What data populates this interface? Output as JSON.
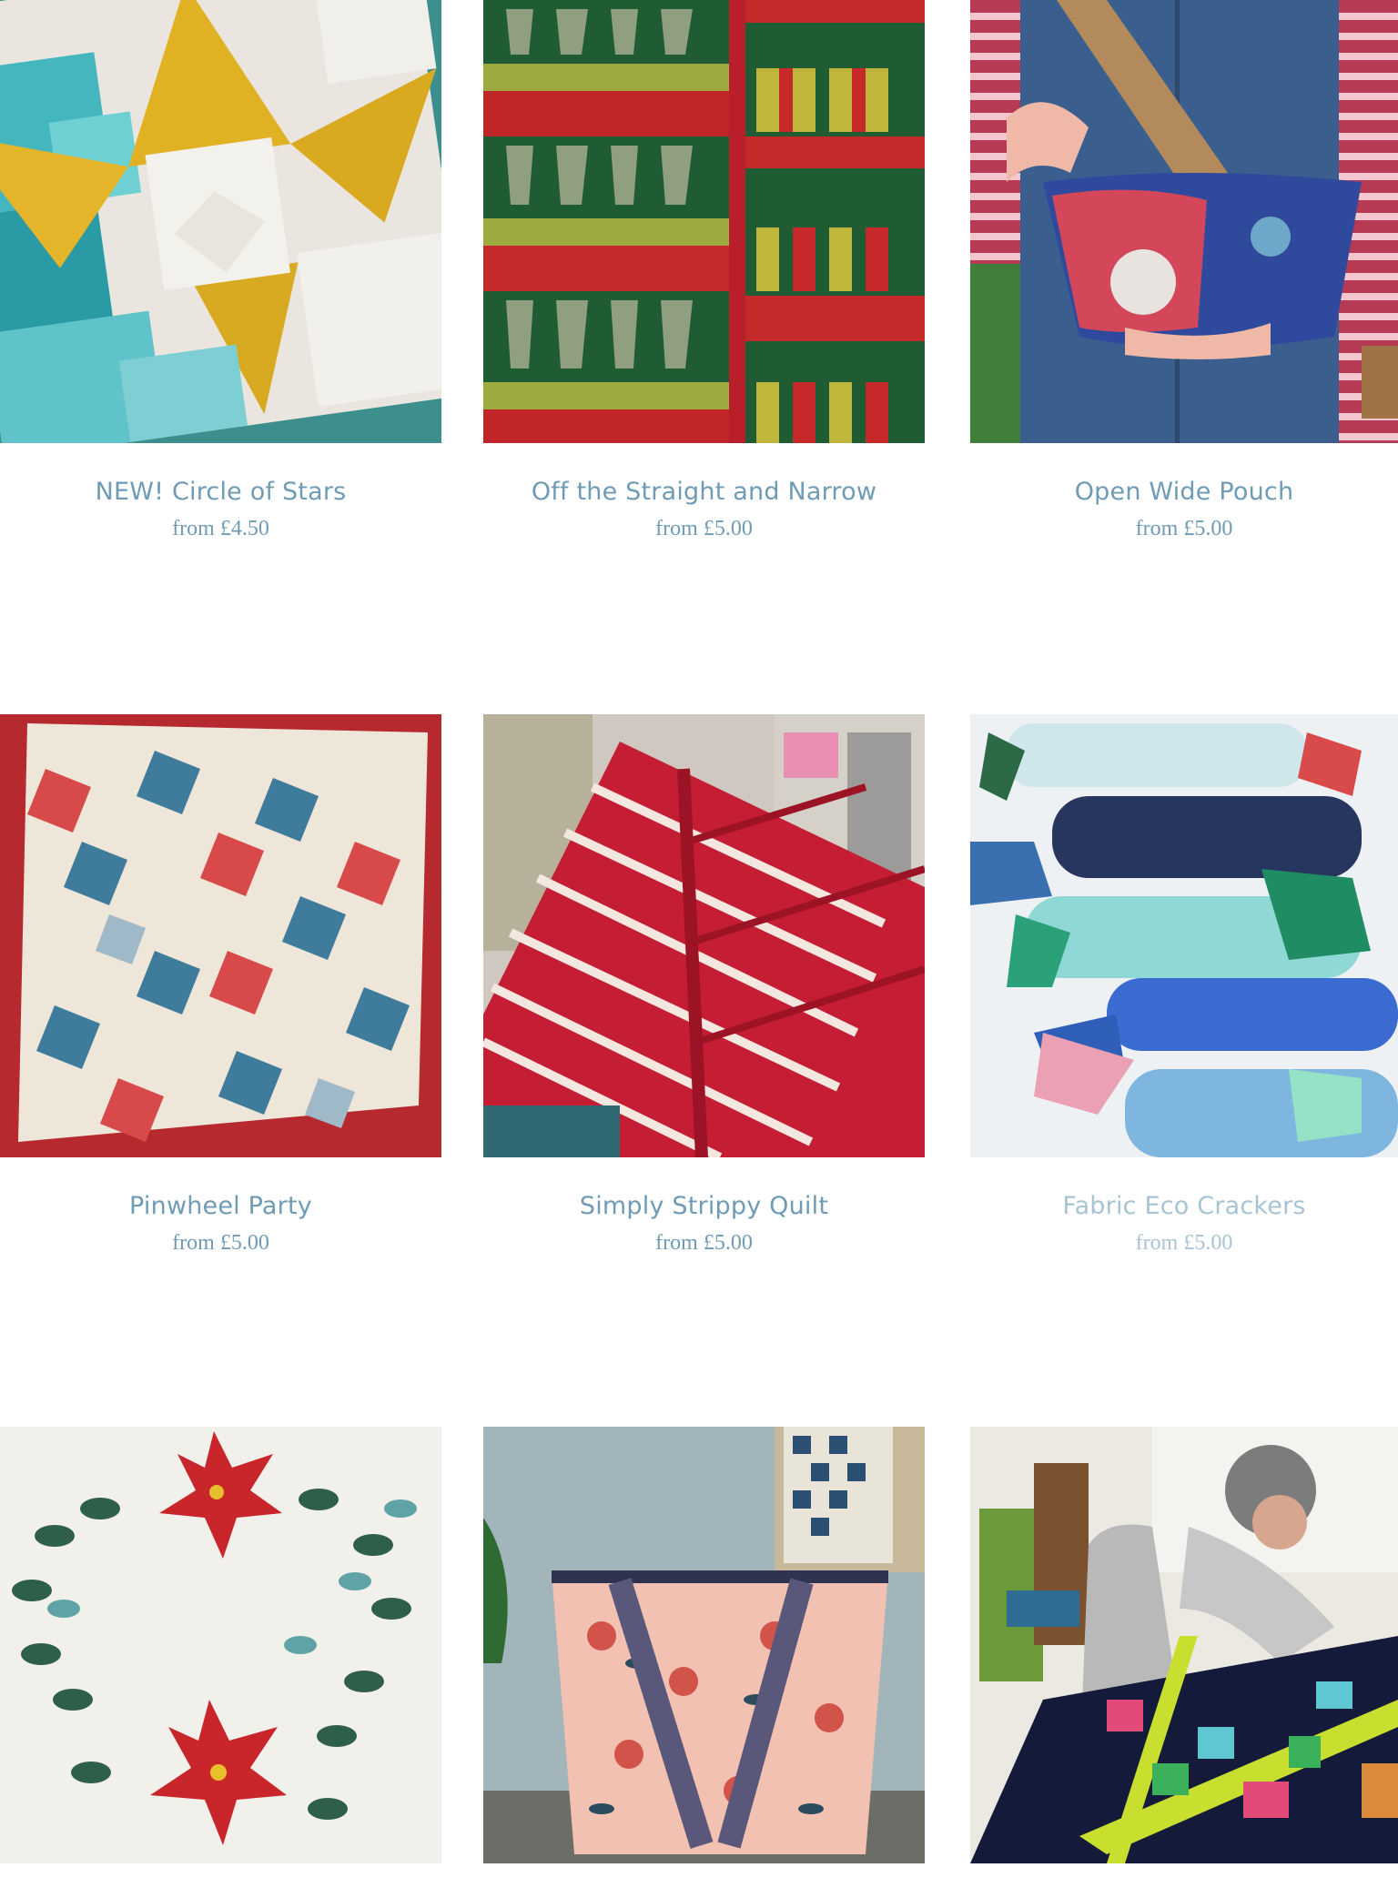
{
  "products": [
    {
      "title": "NEW! Circle of Stars",
      "price": "from £4.50"
    },
    {
      "title": "Off the Straight and Narrow",
      "price": "from £5.00"
    },
    {
      "title": "Open Wide Pouch",
      "price": "from £5.00"
    },
    {
      "title": "Pinwheel Party",
      "price": "from £5.00"
    },
    {
      "title": "Simply Strippy Quilt",
      "price": "from £5.00"
    },
    {
      "title": "Fabric Eco Crackers",
      "price": "from £5.00"
    },
    {
      "title": "",
      "price": ""
    },
    {
      "title": "",
      "price": ""
    },
    {
      "title": "",
      "price": ""
    }
  ]
}
